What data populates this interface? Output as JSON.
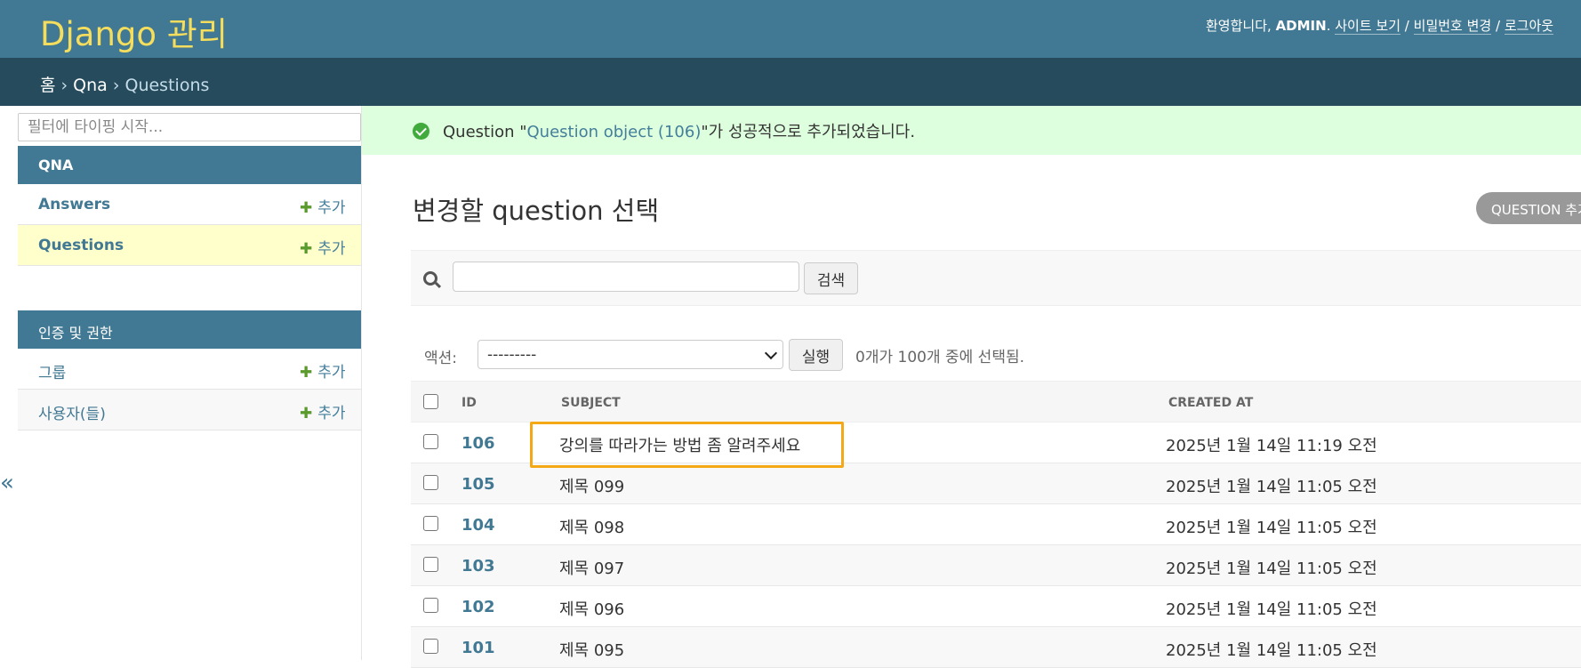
{
  "header": {
    "site_name": "Django 관리",
    "welcome": "환영합니다,",
    "username": "ADMIN",
    "view_site": "사이트 보기",
    "change_password": "비밀번호 변경",
    "logout": "로그아웃",
    "separator": "/"
  },
  "breadcrumbs": {
    "home": "홈",
    "sep": " › ",
    "app": "Qna",
    "current": "Questions"
  },
  "sidebar": {
    "filter_placeholder": "필터에 타이핑 시작...",
    "modules": [
      {
        "caption": "QNA",
        "models": [
          {
            "label": "Answers",
            "add": "추가",
            "current": false
          },
          {
            "label": "Questions",
            "add": "추가",
            "current": true
          }
        ]
      },
      {
        "caption": "인증 및 권한",
        "models": [
          {
            "label": "그룹",
            "add": "추가",
            "current": false
          },
          {
            "label": "사용자(들)",
            "add": "추가",
            "current": false
          }
        ]
      }
    ],
    "toggle": "«"
  },
  "message": {
    "prefix": "Question \"",
    "link": "Question object (106)",
    "suffix": "\"가 성공적으로 추가되었습니다."
  },
  "content": {
    "title": "변경할 question 선택",
    "add_button": "QUESTION 추가 +"
  },
  "search": {
    "button": "검색",
    "value": ""
  },
  "actions": {
    "label": "액션:",
    "selected": "---------",
    "go": "실행",
    "counter": "0개가 100개 중에 선택됨."
  },
  "table": {
    "headers": [
      "ID",
      "SUBJECT",
      "CREATED AT"
    ],
    "rows": [
      {
        "id": "106",
        "subject": "강의를 따라가는 방법 좀 알려주세요",
        "created": "2025년 1월 14일 11:19 오전"
      },
      {
        "id": "105",
        "subject": "제목 099",
        "created": "2025년 1월 14일 11:05 오전"
      },
      {
        "id": "104",
        "subject": "제목 098",
        "created": "2025년 1월 14일 11:05 오전"
      },
      {
        "id": "103",
        "subject": "제목 097",
        "created": "2025년 1월 14일 11:05 오전"
      },
      {
        "id": "102",
        "subject": "제목 096",
        "created": "2025년 1월 14일 11:05 오전"
      },
      {
        "id": "101",
        "subject": "제목 095",
        "created": "2025년 1월 14일 11:05 오전"
      }
    ]
  },
  "colors": {
    "header_bg": "#417893",
    "breadcrumb_bg": "#264b5d",
    "site_name": "#f5dd5d",
    "success_bg": "#ddffdd",
    "highlight": "#f5a816"
  }
}
